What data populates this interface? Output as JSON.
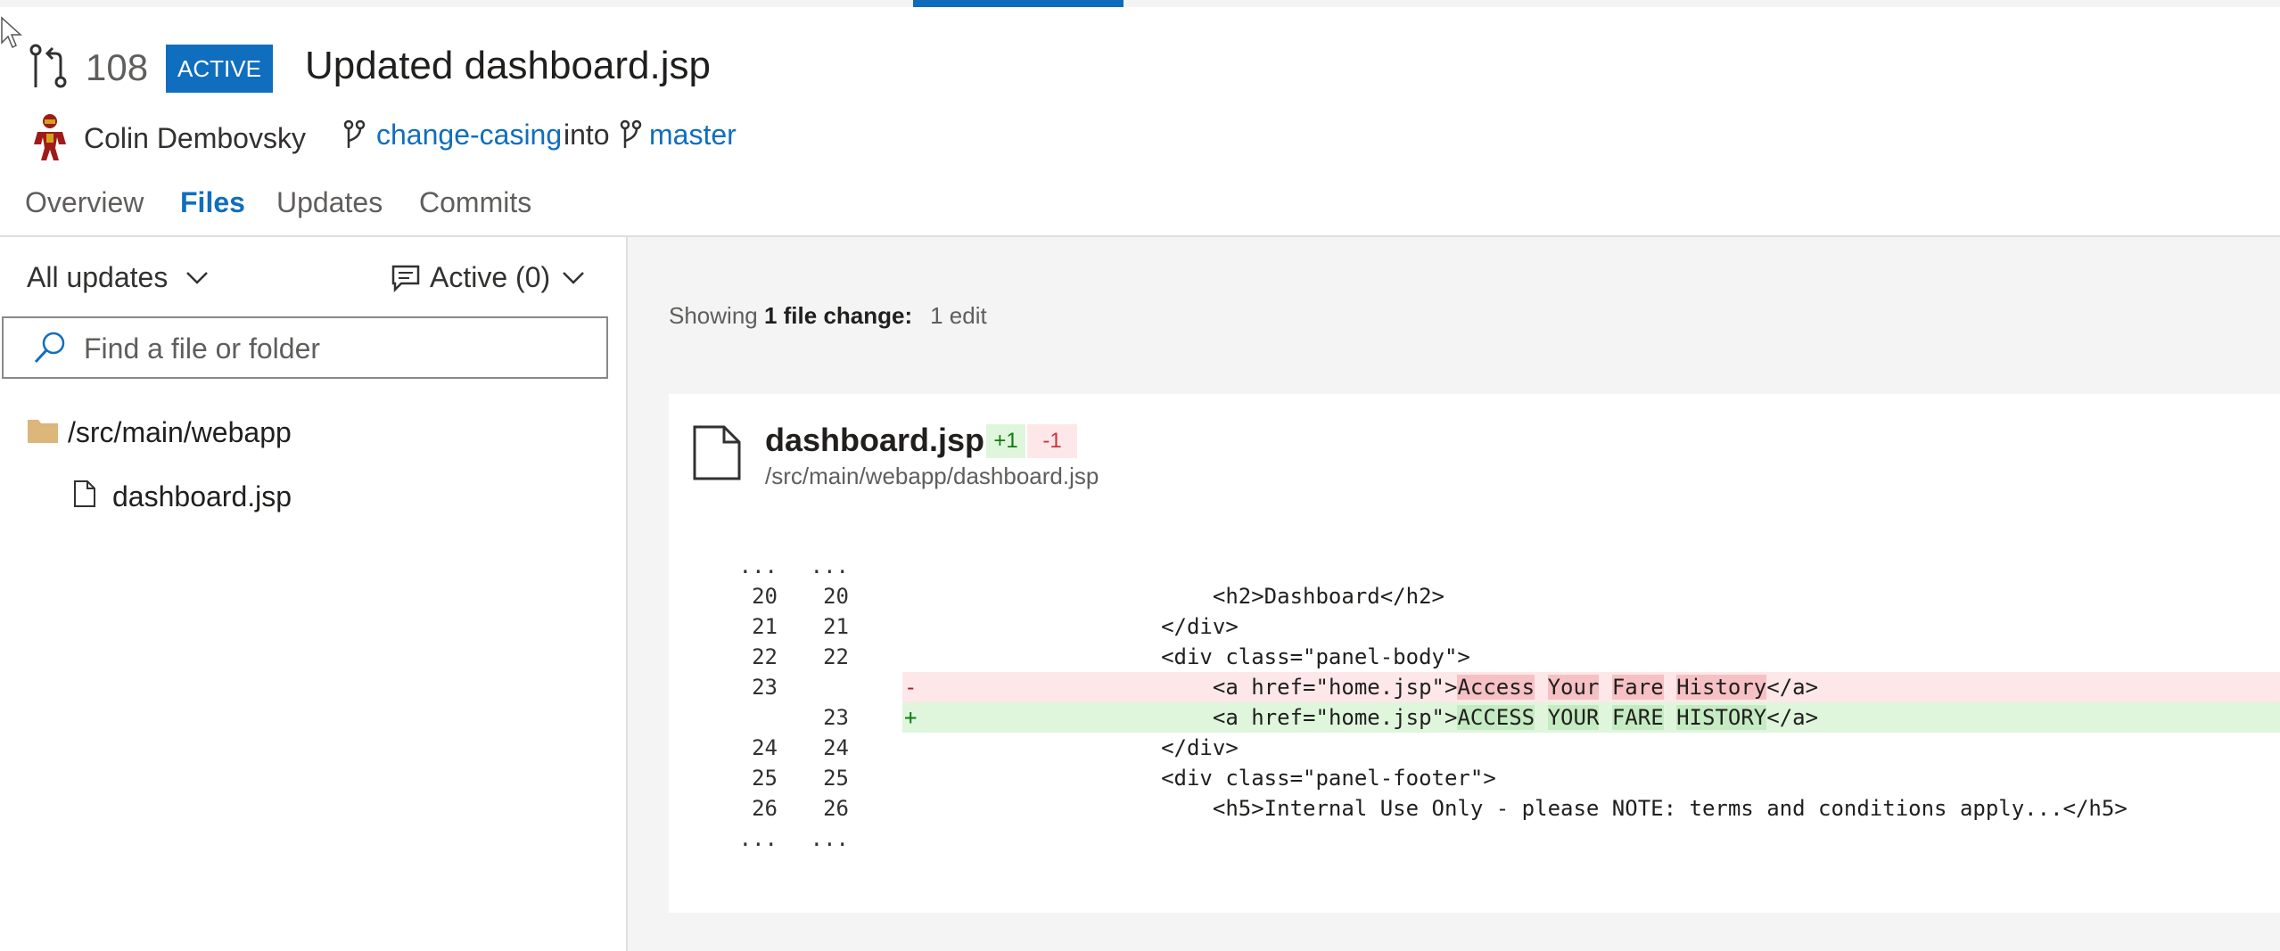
{
  "pr": {
    "id": "108",
    "status": "ACTIVE",
    "title": "Updated dashboard.jsp",
    "author": "Colin Dembovsky",
    "source_branch": "change-casing",
    "into_text": "into",
    "target_branch": "master"
  },
  "tabs": [
    "Overview",
    "Files",
    "Updates",
    "Commits"
  ],
  "selected_tab": "Files",
  "sidebar": {
    "updates_filter": "All updates",
    "comments_filter": "Active (0)",
    "search_placeholder": "Find a file or folder",
    "tree": [
      {
        "type": "folder",
        "label": "/src/main/webapp"
      },
      {
        "type": "file",
        "label": "dashboard.jsp"
      }
    ]
  },
  "summary": {
    "prefix": "Showing",
    "count": "1 file change:",
    "edits": "1 edit"
  },
  "file": {
    "name": "dashboard.jsp",
    "additions": "+1",
    "deletions": "-1",
    "path": "/src/main/webapp/dashboard.jsp"
  },
  "diff_lines": [
    {
      "old": "...",
      "new": "...",
      "marker": "",
      "kind": "context",
      "code": ""
    },
    {
      "old": "20",
      "new": "20",
      "marker": "",
      "kind": "context",
      "code": "                      <h2>Dashboard</h2>"
    },
    {
      "old": "21",
      "new": "21",
      "marker": "",
      "kind": "context",
      "code": "                  </div>"
    },
    {
      "old": "22",
      "new": "22",
      "marker": "",
      "kind": "context",
      "code": "                  <div class=\"panel-body\">"
    },
    {
      "old": "23",
      "new": "",
      "marker": "-",
      "kind": "removed",
      "code": "                      <a href=\"home.jsp\">Access Your Fare History</a>"
    },
    {
      "old": "",
      "new": "23",
      "marker": "+",
      "kind": "added",
      "code": "                      <a href=\"home.jsp\">ACCESS YOUR FARE HISTORY</a>"
    },
    {
      "old": "24",
      "new": "24",
      "marker": "",
      "kind": "context",
      "code": "                  </div>"
    },
    {
      "old": "25",
      "new": "25",
      "marker": "",
      "kind": "context",
      "code": "                  <div class=\"panel-footer\">"
    },
    {
      "old": "26",
      "new": "26",
      "marker": "",
      "kind": "context",
      "code": "                      <h5>Internal Use Only - please NOTE: terms and conditions apply...</h5>"
    },
    {
      "old": "...",
      "new": "...",
      "marker": "",
      "kind": "context",
      "code": ""
    }
  ],
  "colors": {
    "accent": "#106ebe",
    "status_badge": "#106ebe",
    "added_bg": "#dff6dd",
    "removed_bg": "#fde7e9",
    "folder": "#dcb67a"
  }
}
